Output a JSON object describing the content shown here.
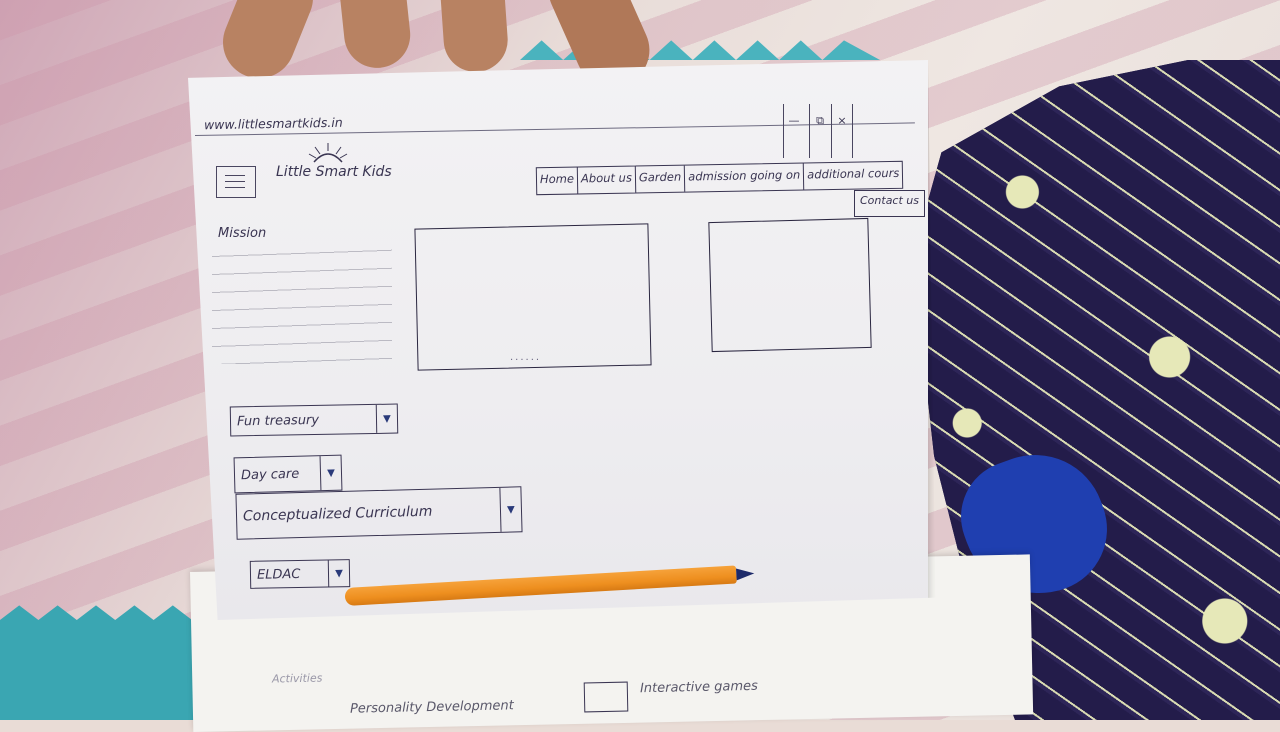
{
  "browser": {
    "url": "www.littlesmartkids.in",
    "controls": [
      "—",
      "⧉",
      "×"
    ]
  },
  "header": {
    "brand": "Little Smart Kids"
  },
  "nav": {
    "items": [
      "Home",
      "About us",
      "Garden",
      "admission going on",
      "additional cours"
    ],
    "extra": "Contact us"
  },
  "main": {
    "mission_label": "Mission",
    "image_dots": "......"
  },
  "dropdowns": [
    {
      "label": "Fun treasury"
    },
    {
      "label": "Day care"
    },
    {
      "label": "Conceptualized Curriculum"
    },
    {
      "label": "ELDAC"
    }
  ],
  "lower_page": {
    "activities": "Activities",
    "development": "Personality Development",
    "interactive": "Interactive games"
  },
  "colors": {
    "ink": "#3a3552",
    "pencil": "#ee8f1f",
    "cloth": "#241d4b"
  }
}
